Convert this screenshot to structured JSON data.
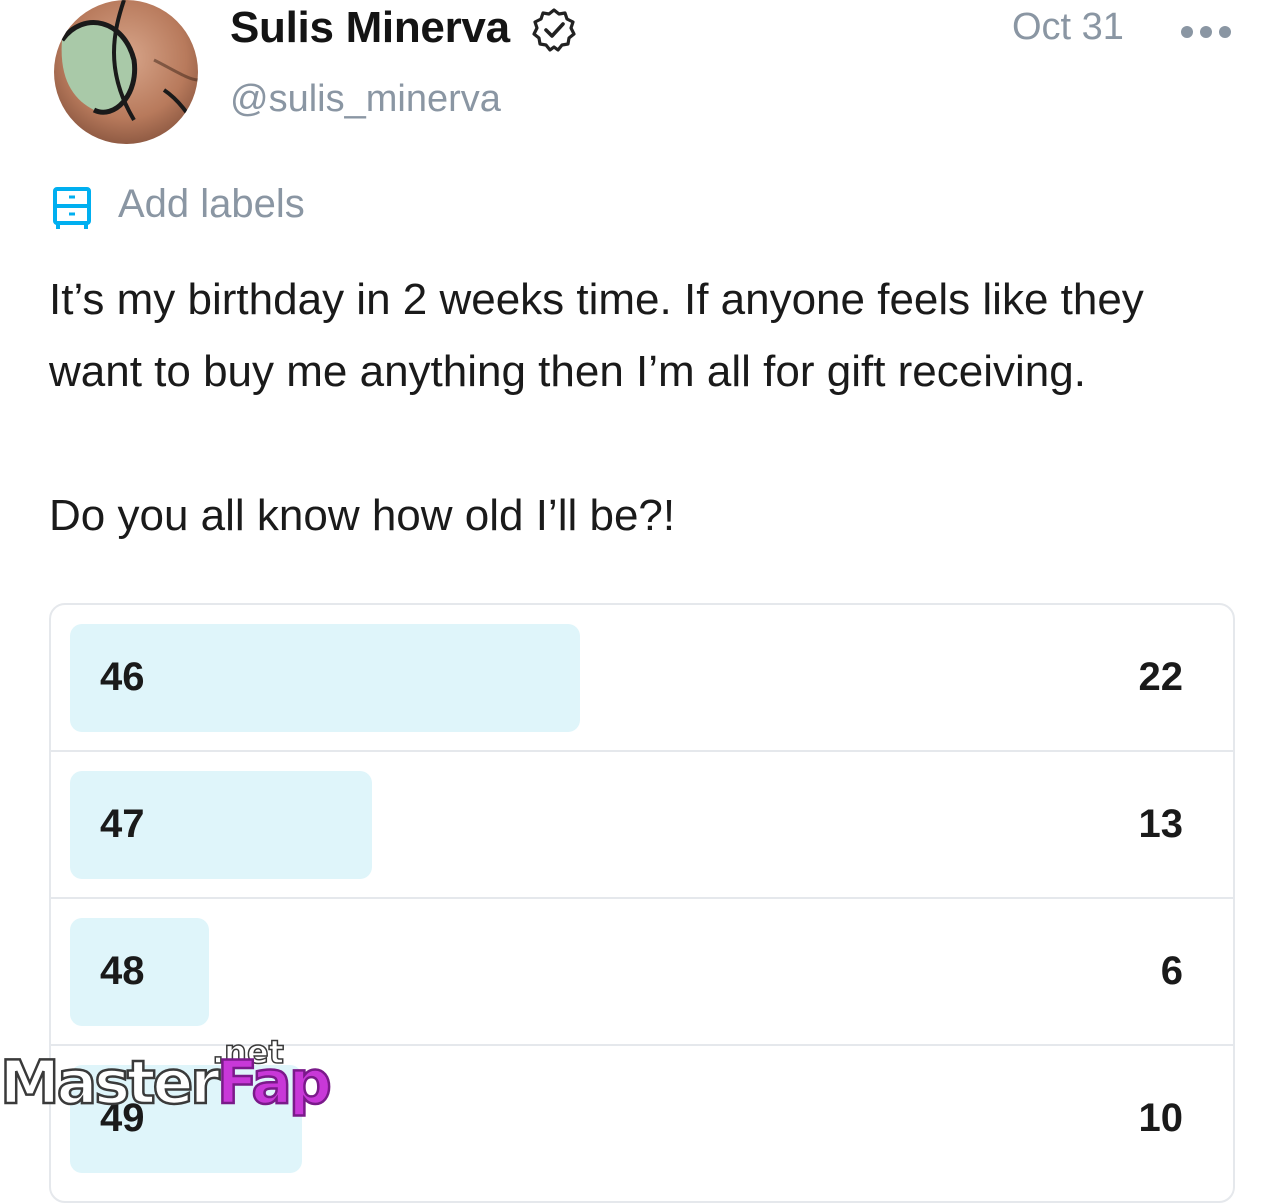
{
  "post": {
    "author_name": "Sulis Minerva",
    "handle": "@sulis_minerva",
    "date": "Oct 31",
    "verified": true,
    "labels_action": "Add labels",
    "text_line1": "It’s my birthday in 2 weeks time. If anyone feels like they",
    "text_line2": "want to buy me anything then I’m all for gift receiving.",
    "text_line3": "Do you all know how old I’ll be?!"
  },
  "poll": {
    "options": [
      {
        "label": "46",
        "count": "22",
        "fill_fraction": 0.44
      },
      {
        "label": "47",
        "count": "13",
        "fill_fraction": 0.26
      },
      {
        "label": "48",
        "count": "6",
        "fill_fraction": 0.12
      },
      {
        "label": "49",
        "count": "10",
        "fill_fraction": 0.2
      }
    ]
  },
  "icons": {
    "verified": "verified-badge-icon",
    "more": "more-dots-icon",
    "labels": "labels-drawer-icon"
  },
  "colors": {
    "accent": "#00aff0",
    "muted_text": "#8a96a3",
    "poll_fill": "#dff5fa",
    "border": "#e5e8ec"
  },
  "watermark": {
    "brand_part1": "Master",
    "brand_part2": "Fap",
    "brand_suffix": ".net"
  }
}
